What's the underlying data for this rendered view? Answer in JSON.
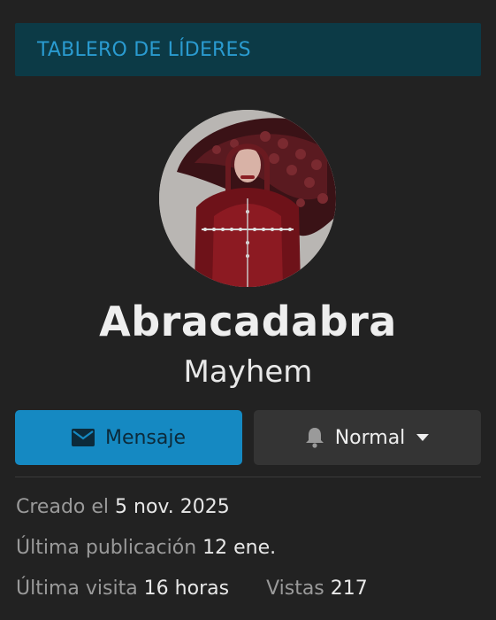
{
  "banner": {
    "title": "TABLERO DE LÍDERES"
  },
  "profile": {
    "username": "Abracadabra",
    "subtitle": "Mayhem"
  },
  "actions": {
    "message_label": "Mensaje",
    "notification_label": "Normal"
  },
  "stats": {
    "created_label": "Creado el",
    "created_value": "5 nov. 2025",
    "last_post_label": "Última publicación",
    "last_post_value": "12 ene.",
    "last_visit_label": "Última visita",
    "last_visit_value": "16 horas",
    "views_label": "Vistas",
    "views_value": "217"
  },
  "icons": {
    "message": "envelope-icon",
    "notification": "bell-icon",
    "dropdown": "caret-down-icon"
  },
  "colors": {
    "background": "#222222",
    "banner_bg": "#0c3a46",
    "banner_text": "#2a9bd0",
    "primary_button": "#1589c2",
    "secondary_button": "#343434",
    "muted_text": "#9a9a9a"
  }
}
